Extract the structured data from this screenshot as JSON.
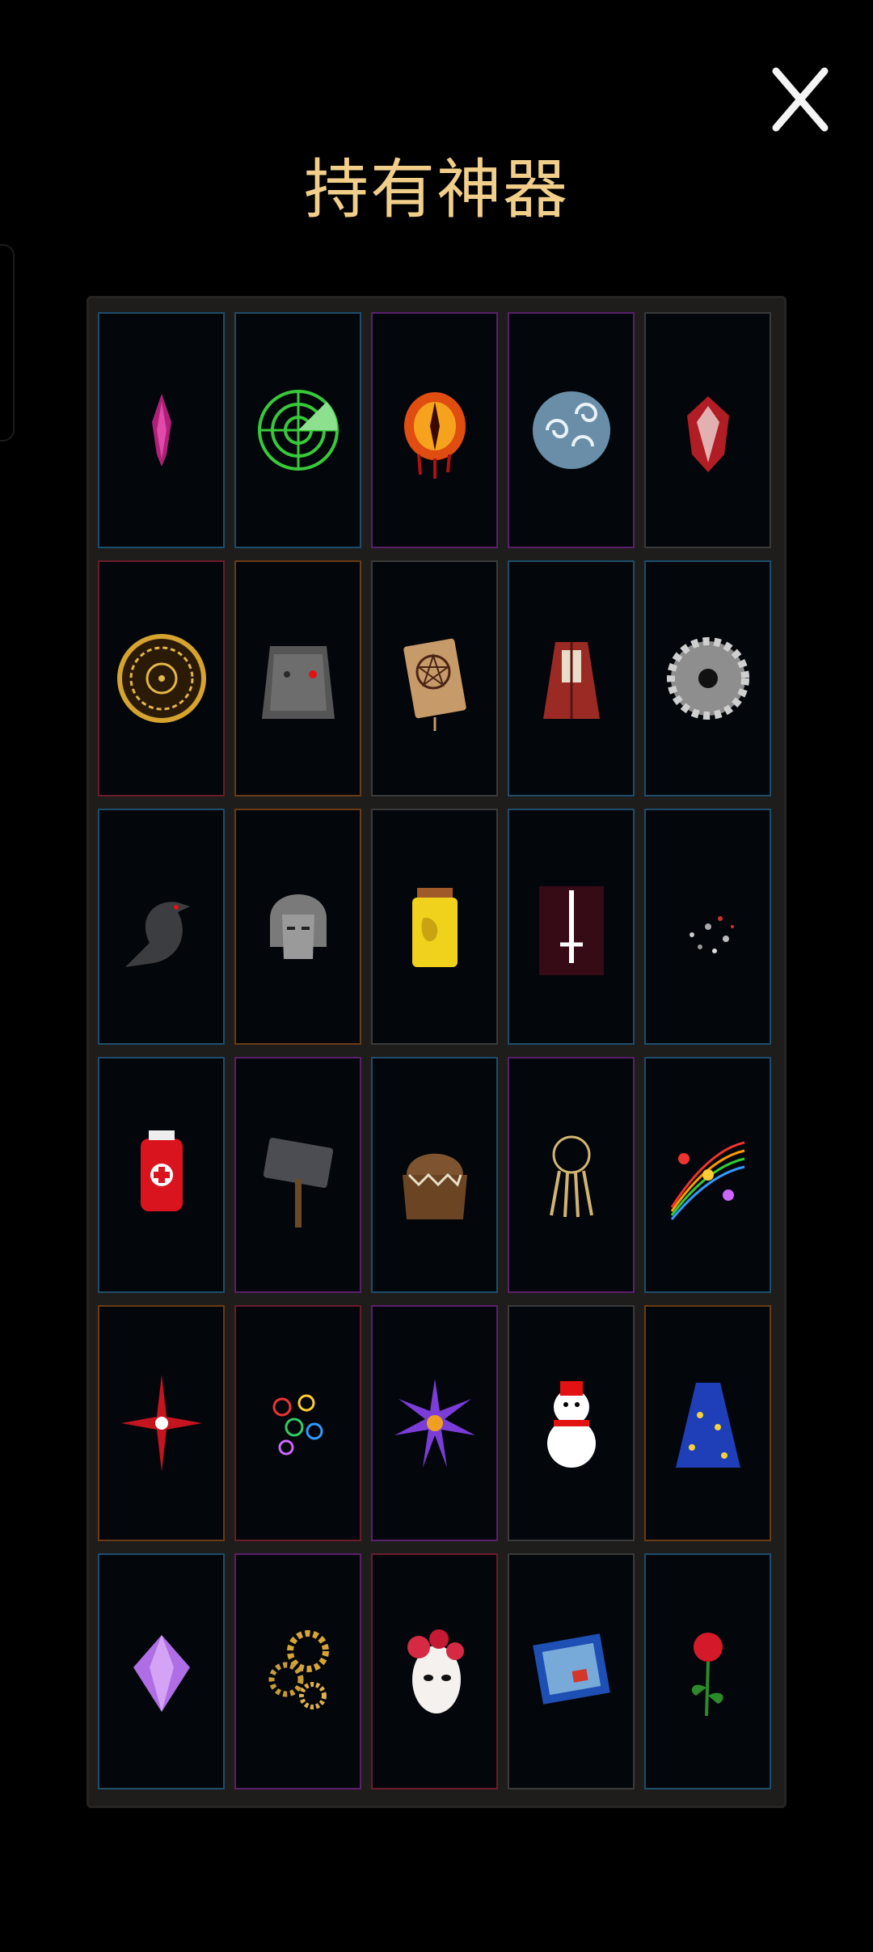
{
  "header": {
    "title": "持有神器",
    "close_icon": "close-icon"
  },
  "colors": {
    "title": "#f1cf8a",
    "panel": "#1e1d1c",
    "rarity": {
      "blue": "#1d4d6b",
      "purple": "#5a1f6a",
      "red": "#6a1c2a",
      "orange": "#6a3b14",
      "gray": "#3a3a3a"
    }
  },
  "artifacts": [
    {
      "icon": "magenta-crystal-shard-icon",
      "rarity": "blue"
    },
    {
      "icon": "green-radar-icon",
      "rarity": "blue"
    },
    {
      "icon": "burning-eye-icon",
      "rarity": "purple"
    },
    {
      "icon": "swirling-cloud-orb-icon",
      "rarity": "purple"
    },
    {
      "icon": "red-heart-crystal-icon",
      "rarity": "gray"
    },
    {
      "icon": "golden-clock-dial-icon",
      "rarity": "red"
    },
    {
      "icon": "stone-golem-face-icon",
      "rarity": "orange"
    },
    {
      "icon": "pentagram-book-icon",
      "rarity": "gray"
    },
    {
      "icon": "red-robe-icon",
      "rarity": "blue"
    },
    {
      "icon": "saw-blade-icon",
      "rarity": "blue"
    },
    {
      "icon": "black-raven-icon",
      "rarity": "blue"
    },
    {
      "icon": "iron-mask-helmet-icon",
      "rarity": "orange"
    },
    {
      "icon": "yellow-jar-icon",
      "rarity": "gray"
    },
    {
      "icon": "glowing-dagger-icon",
      "rarity": "blue"
    },
    {
      "icon": "scattered-dust-icon",
      "rarity": "blue"
    },
    {
      "icon": "blood-bag-icon",
      "rarity": "blue"
    },
    {
      "icon": "stone-hammer-icon",
      "rarity": "purple"
    },
    {
      "icon": "mimic-chest-icon",
      "rarity": "blue"
    },
    {
      "icon": "key-ring-icon",
      "rarity": "purple"
    },
    {
      "icon": "music-notes-icon",
      "rarity": "blue"
    },
    {
      "icon": "red-star-sparkle-icon",
      "rarity": "orange"
    },
    {
      "icon": "colorful-rings-icon",
      "rarity": "red"
    },
    {
      "icon": "purple-spiky-orb-icon",
      "rarity": "purple"
    },
    {
      "icon": "snowman-icon",
      "rarity": "gray"
    },
    {
      "icon": "starry-blue-cape-icon",
      "rarity": "orange"
    },
    {
      "icon": "purple-gem-icon",
      "rarity": "blue"
    },
    {
      "icon": "golden-gears-icon",
      "rarity": "purple"
    },
    {
      "icon": "rose-mask-icon",
      "rarity": "red"
    },
    {
      "icon": "painting-frame-icon",
      "rarity": "gray"
    },
    {
      "icon": "red-rose-icon",
      "rarity": "blue"
    }
  ]
}
